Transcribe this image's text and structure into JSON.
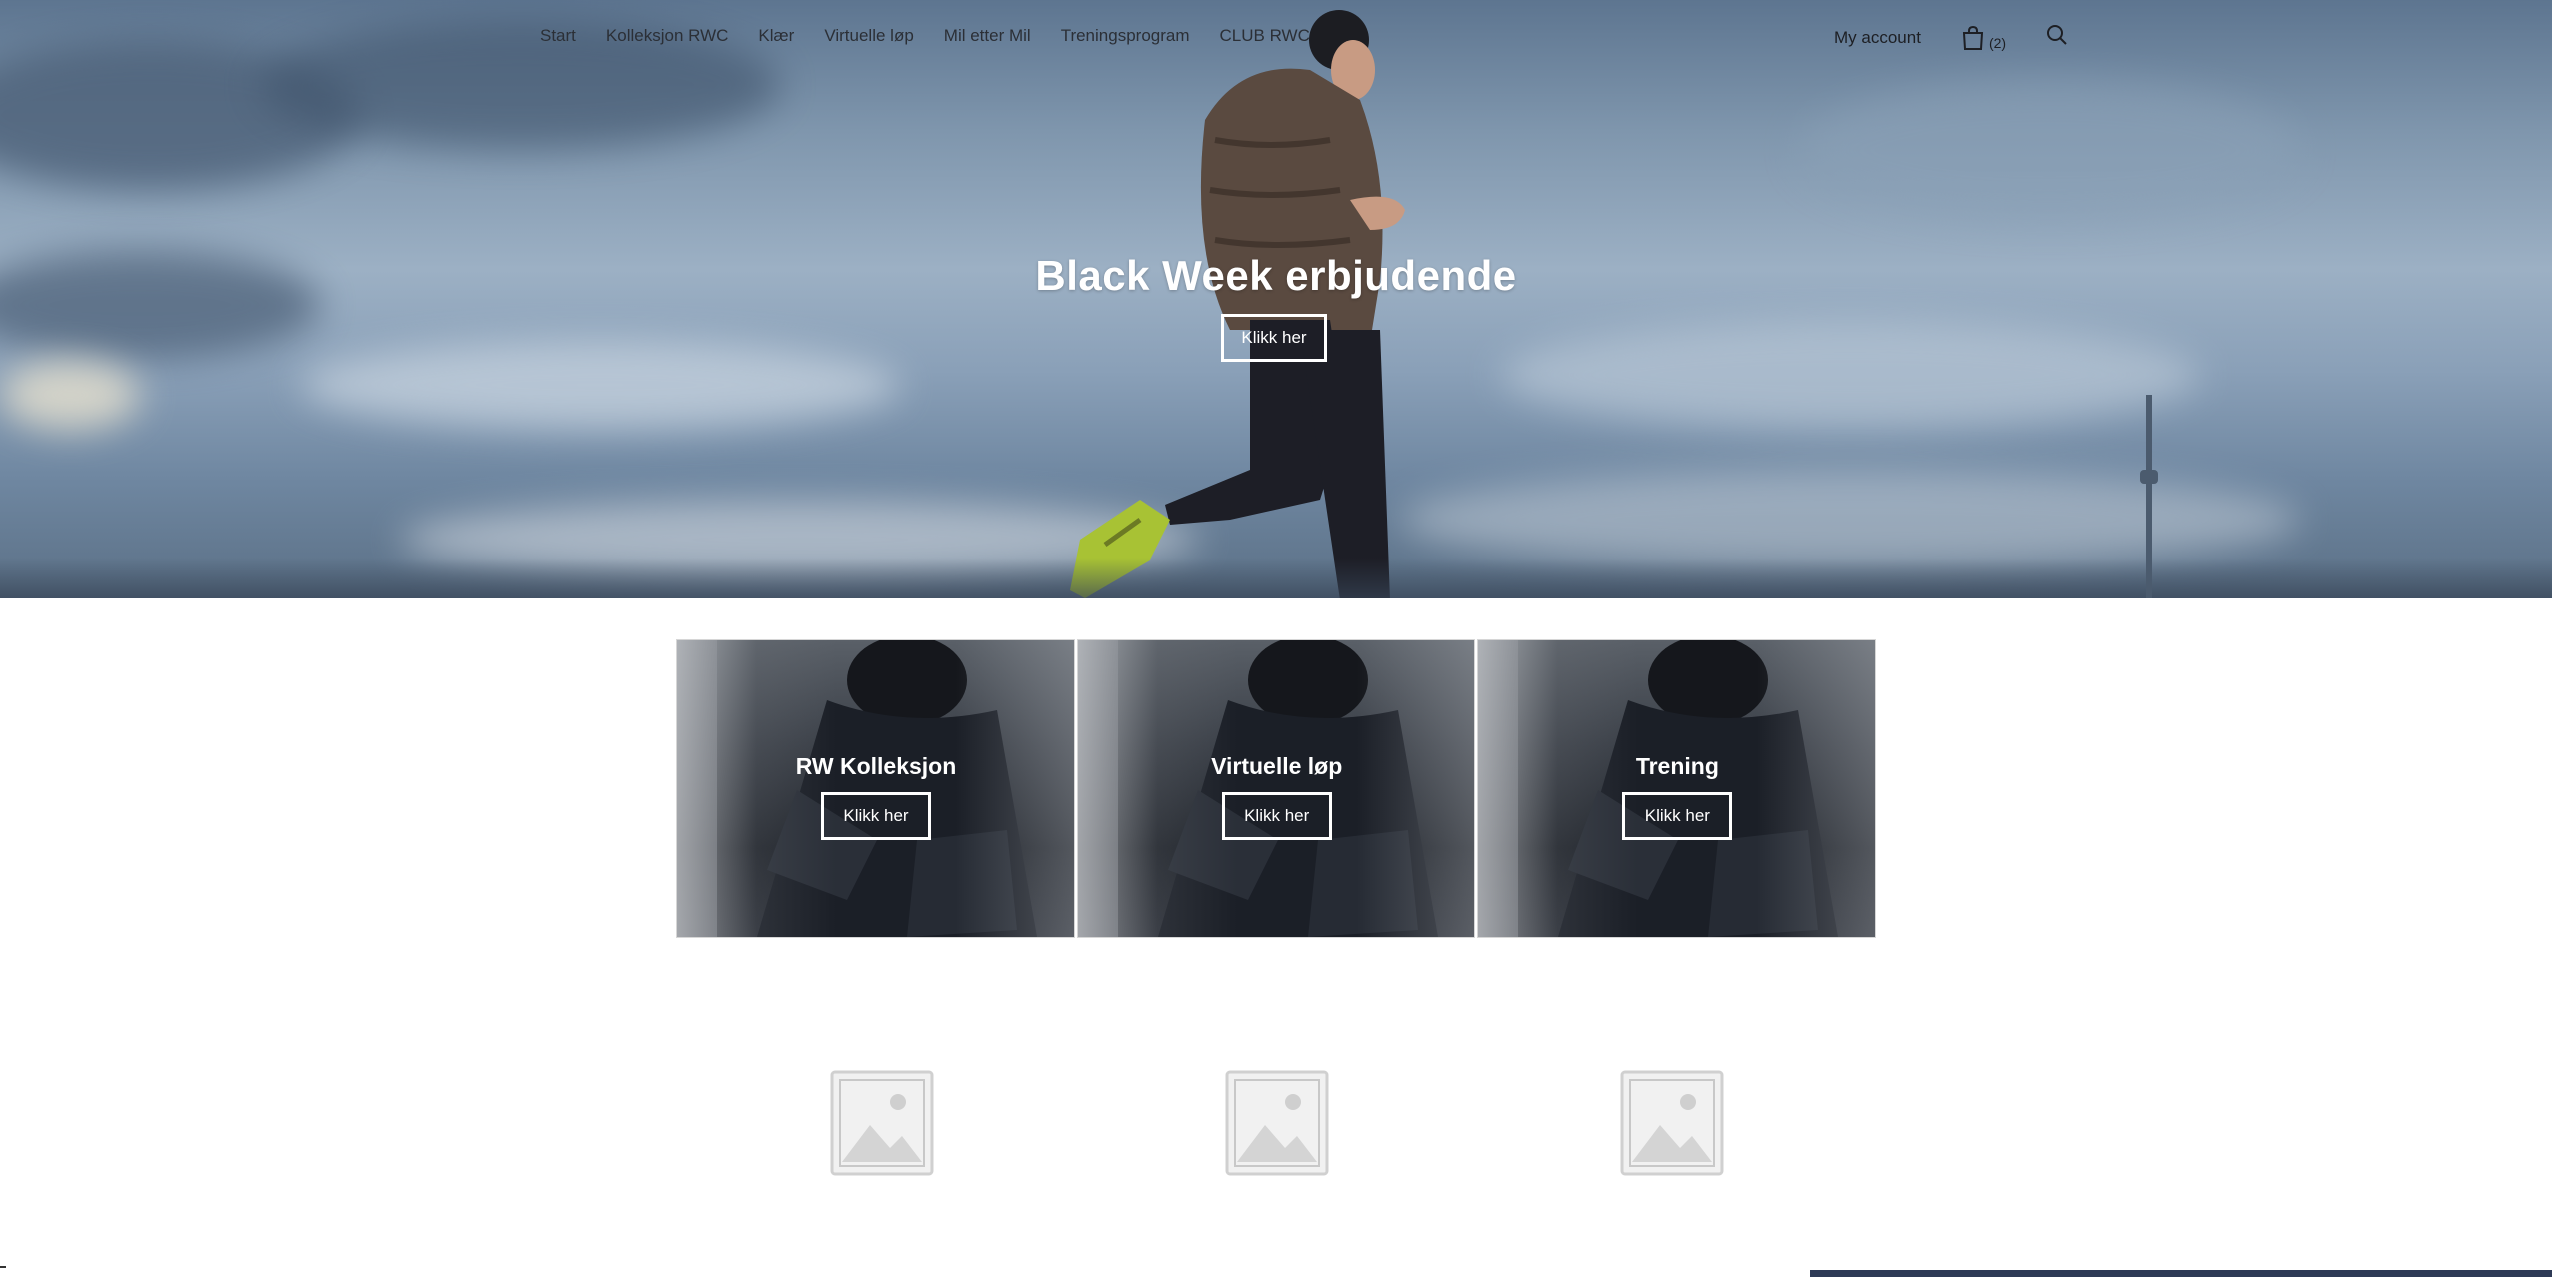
{
  "nav": {
    "items": [
      {
        "label": "Start"
      },
      {
        "label": "Kolleksjon RWC"
      },
      {
        "label": "Klær"
      },
      {
        "label": "Virtuelle løp"
      },
      {
        "label": "Mil etter Mil"
      },
      {
        "label": "Treningsprogram"
      },
      {
        "label": "CLUB RWC"
      }
    ],
    "account_label": "My account",
    "cart_count": "(2)",
    "icons": {
      "cart": "shopping-bag-icon",
      "search": "search-icon"
    }
  },
  "hero": {
    "title": "Black Week erbjudende",
    "button_label": "Klikk her"
  },
  "tiles": [
    {
      "title": "RW Kolleksjon",
      "button_label": "Klikk her"
    },
    {
      "title": "Virtuelle løp",
      "button_label": "Klikk her"
    },
    {
      "title": "Trening",
      "button_label": "Klikk her"
    }
  ],
  "placeholders": [
    {
      "icon": "image-placeholder-icon"
    },
    {
      "icon": "image-placeholder-icon"
    },
    {
      "icon": "image-placeholder-icon"
    }
  ],
  "colors": {
    "hero_sky": "#7f96ad",
    "text_dark": "#2b2f36",
    "button_border": "#ffffff",
    "bottom_bar": "#2e3a56"
  }
}
